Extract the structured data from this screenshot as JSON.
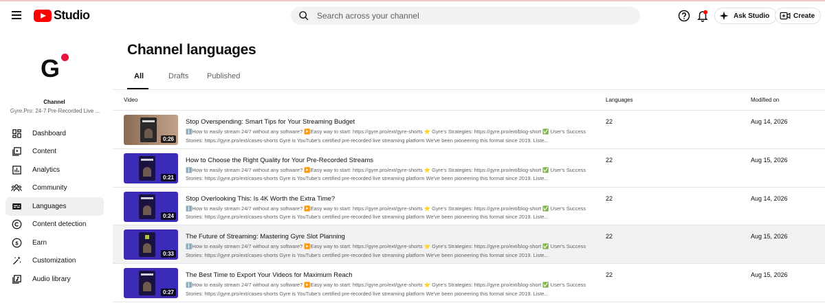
{
  "app": {
    "title": "Studio"
  },
  "search": {
    "placeholder": "Search across your channel"
  },
  "header": {
    "ask_label": "Ask Studio",
    "create_label": "Create"
  },
  "channel": {
    "avatar_letter": "G",
    "label": "Channel",
    "name": "Gyre.Pro: 24-7 Pre-Recorded Live ..."
  },
  "sidebar": {
    "items": [
      {
        "label": "Dashboard",
        "icon": "dashboard-icon"
      },
      {
        "label": "Content",
        "icon": "content-icon"
      },
      {
        "label": "Analytics",
        "icon": "analytics-icon"
      },
      {
        "label": "Community",
        "icon": "community-icon"
      },
      {
        "label": "Languages",
        "icon": "languages-icon",
        "active": true
      },
      {
        "label": "Content detection",
        "icon": "copyright-icon"
      },
      {
        "label": "Earn",
        "icon": "earn-icon"
      },
      {
        "label": "Customization",
        "icon": "customization-icon"
      },
      {
        "label": "Audio library",
        "icon": "audio-library-icon"
      }
    ]
  },
  "page": {
    "title": "Channel languages"
  },
  "tabs": [
    {
      "label": "All",
      "active": true
    },
    {
      "label": "Drafts"
    },
    {
      "label": "Published"
    }
  ],
  "table": {
    "columns": {
      "video": "Video",
      "languages": "Languages",
      "modified": "Modified on"
    },
    "rows": [
      {
        "title": "Stop Overspending: Smart Tips for Your Streaming Budget",
        "description": "ℹ️How to easily stream 24/7 without any software? ▶️Easy way to start: https://gyre.pro/ext/gyre-shorts ⭐ Gyre's Strategies: https://gyre.pro/ext/blog-short ✅ User's Success Stories: https://gyre.pro/ext/cases-shorts Gyre is YouTube's certified pre-recorded live streaming platform We've been pioneering this format since 2019. Liste...",
        "duration": "0:26",
        "languages": "22",
        "modified": "Aug 14, 2026"
      },
      {
        "title": "How to Choose the Right Quality for Your Pre-Recorded Streams",
        "description": "ℹ️How to easily stream 24/7 without any software? ▶️Easy way to start: https://gyre.pro/ext/gyre-shorts ⭐ Gyre's Strategies: https://gyre.pro/ext/blog-short ✅ User's Success Stories: https://gyre.pro/ext/cases-shorts Gyre is YouTube's certified pre-recorded live streaming platform We've been pioneering this format since 2019. Liste...",
        "duration": "0:21",
        "languages": "22",
        "modified": "Aug 15, 2026"
      },
      {
        "title": "Stop Overlooking This: Is 4K Worth the Extra Time?",
        "description": "ℹ️How to easily stream 24/7 without any software? ▶️Easy way to start: https://gyre.pro/ext/gyre-shorts ⭐ Gyre's Strategies: https://gyre.pro/ext/blog-short ✅ User's Success Stories: https://gyre.pro/ext/cases-shorts Gyre is YouTube's certified pre-recorded live streaming platform We've been pioneering this format since 2019. Liste...",
        "duration": "0:24",
        "languages": "22",
        "modified": "Aug 14, 2026"
      },
      {
        "title": "The Future of Streaming: Mastering Gyre Slot Planning",
        "description": "ℹ️How to easily stream 24/7 without any software? ▶️Easy way to start: https://gyre.pro/ext/gyre-shorts ⭐ Gyre's Strategies: https://gyre.pro/ext/blog-short ✅ User's Success Stories: https://gyre.pro/ext/cases-shorts Gyre is YouTube's certified pre-recorded live streaming platform We've been pioneering this format since 2019. Liste...",
        "duration": "0:33",
        "languages": "22",
        "modified": "Aug 15, 2026"
      },
      {
        "title": "The Best Time to Export Your Videos for Maximum Reach",
        "description": "ℹ️How to easily stream 24/7 without any software? ▶️Easy way to start: https://gyre.pro/ext/gyre-shorts ⭐ Gyre's Strategies: https://gyre.pro/ext/blog-short ✅ User's Success Stories: https://gyre.pro/ext/cases-shorts Gyre is YouTube's certified pre-recorded live streaming platform We've been pioneering this format since 2019. Liste...",
        "duration": "0:27",
        "languages": "22",
        "modified": "Aug 15, 2026"
      }
    ]
  },
  "colors": {
    "brand_red": "#ff0000",
    "avatar_dot": "#e8123b",
    "active_nav_bg": "#f0f0f0",
    "hover_row_bg": "#f2f2f2",
    "thumb_purple": "#3a2bb8"
  }
}
